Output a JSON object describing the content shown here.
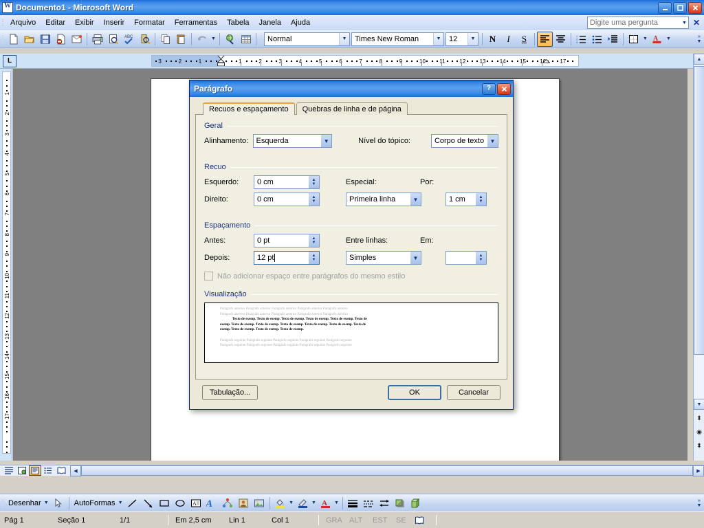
{
  "window": {
    "title": "Documento1 - Microsoft Word",
    "app_icon": "word-document-icon",
    "minimize": "_",
    "maximize": "□",
    "close": "✕"
  },
  "menubar": {
    "items": [
      {
        "label": "Arquivo",
        "accel": "A"
      },
      {
        "label": "Editar",
        "accel": "E"
      },
      {
        "label": "Exibir",
        "accel": "x"
      },
      {
        "label": "Inserir",
        "accel": "I"
      },
      {
        "label": "Formatar",
        "accel": "F"
      },
      {
        "label": "Ferramentas",
        "accel": "m"
      },
      {
        "label": "Tabela",
        "accel": "b"
      },
      {
        "label": "Janela",
        "accel": "J"
      },
      {
        "label": "Ajuda",
        "accel": "u"
      }
    ],
    "ask_placeholder": "Digite uma pergunta",
    "ask_value": "",
    "close_label": "✕"
  },
  "formatting_toolbar": {
    "style": "Normal",
    "font": "Times New Roman",
    "size": "12",
    "bold_label": "N",
    "italic_label": "I",
    "underline_label": "S"
  },
  "ruler": {
    "tab_selector": "L",
    "h_ticks": [
      "3",
      "2",
      "1",
      "1",
      "2",
      "3",
      "4",
      "5",
      "6",
      "7",
      "8",
      "9",
      "10",
      "11",
      "12",
      "13",
      "14",
      "15",
      "16",
      "17"
    ],
    "v_ticks": [
      "1",
      "2",
      "3",
      "4",
      "5",
      "6",
      "7",
      "8",
      "9",
      "10",
      "11",
      "12",
      "13",
      "14",
      "15",
      "16",
      "17"
    ]
  },
  "dialog": {
    "title": "Parágrafo",
    "help_label": "?",
    "close_label": "✕",
    "tabs": [
      {
        "label": "Recuos e espaçamento",
        "active": true
      },
      {
        "label": "Quebras de linha e de página",
        "active": false
      }
    ],
    "geral": {
      "legend": "Geral",
      "alignment_label": "Alinhamento:",
      "alignment_value": "Esquerda",
      "outline_label": "Nível do tópico:",
      "outline_value": "Corpo de texto"
    },
    "recuo": {
      "legend": "Recuo",
      "left_label": "Esquerdo:",
      "left_value": "0 cm",
      "right_label": "Direito:",
      "right_value": "0 cm",
      "special_label": "Especial:",
      "special_value": "Primeira linha",
      "by_label": "Por:",
      "by_value": "1 cm"
    },
    "espacamento": {
      "legend": "Espaçamento",
      "before_label": "Antes:",
      "before_value": "0 pt",
      "after_label": "Depois:",
      "after_value": "12 pt",
      "linespacing_label": "Entre linhas:",
      "linespacing_value": "Simples",
      "at_label": "Em:",
      "at_value": ""
    },
    "checkbox_label": "Não adicionar espaço entre parágrafos do mesmo estilo",
    "checkbox_checked": false,
    "checkbox_enabled": false,
    "preview": {
      "legend": "Visualização",
      "prev_line1": "Parágrafo anterior Parágrafo anterior Parágrafo anterior Parágrafo anterior Parágrafo anterior",
      "prev_line2": "Parágrafo anterior Parágrafo anterior Parágrafo anterior Parágrafo anterior Parágrafo anterior",
      "body_line1": "Texto de exemp. Texto de exemp. Texto de exemp. Texto de exemp. Texto de exemp. Texto de",
      "body_line2": "exemp. Texto de exemp. Texto de exemp. Texto de exemp. Texto de exemp. Texto de exemp. Texto de",
      "body_line3": "exemp. Texto de exemp. Texto de exemp. Texto de exemp.",
      "next_line1": "Parágrafo seguinte Parágrafo seguinte Parágrafo seguinte Parágrafo seguinte Parágrafo seguinte",
      "next_line2": "Parágrafo seguinte Parágrafo seguinte Parágrafo seguinte Parágrafo seguinte Parágrafo seguinte"
    },
    "buttons": {
      "tabs_label": "Tabulação...",
      "ok_label": "OK",
      "cancel_label": "Cancelar"
    }
  },
  "drawing_toolbar": {
    "draw_label": "Desenhar",
    "autoshapes_label": "AutoFormas"
  },
  "statusbar": {
    "page_label": "Pág 1",
    "section_label": "Seção 1",
    "pages_label": "1/1",
    "at_label": "Em 2,5 cm",
    "line_label": "Lin 1",
    "col_label": "Col 1",
    "rec_label": "GRA",
    "trk_label": "ALT",
    "ext_label": "EST",
    "ovr_label": "SE",
    "lang_label": ""
  },
  "colors": {
    "title_blue": "#3f8ce8",
    "dialog_face": "#ece9d8",
    "panel_face": "#f1efe2",
    "group_label": "#15317e",
    "accent_orange": "#e8a33d",
    "close_red": "#d23a16"
  }
}
